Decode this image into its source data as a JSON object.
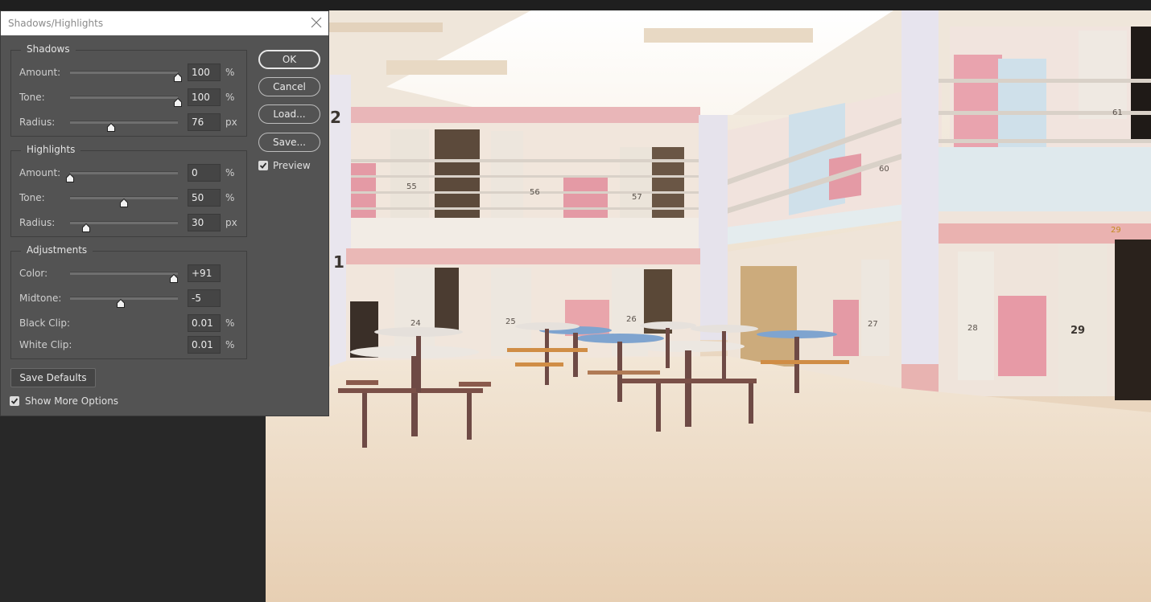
{
  "window": {
    "title": "Shadows/Highlights"
  },
  "shadows": {
    "title": "Shadows",
    "amount": {
      "label": "Amount:",
      "value": "100",
      "unit": "%",
      "level": 1.0
    },
    "tone": {
      "label": "Tone:",
      "value": "100",
      "unit": "%",
      "level": 1.0
    },
    "radius": {
      "label": "Radius:",
      "value": "76",
      "unit": "px",
      "level": 0.38
    }
  },
  "highlights": {
    "title": "Highlights",
    "amount": {
      "label": "Amount:",
      "value": "0",
      "unit": "%",
      "level": 0.0
    },
    "tone": {
      "label": "Tone:",
      "value": "50",
      "unit": "%",
      "level": 0.5
    },
    "radius": {
      "label": "Radius:",
      "value": "30",
      "unit": "px",
      "level": 0.15
    }
  },
  "adjustments": {
    "title": "Adjustments",
    "color": {
      "label": "Color:",
      "value": "+91",
      "level": 0.96
    },
    "midtone": {
      "label": "Midtone:",
      "value": "-5",
      "level": 0.47
    },
    "black_clip": {
      "label": "Black Clip:",
      "value": "0.01",
      "unit": "%"
    },
    "white_clip": {
      "label": "White Clip:",
      "value": "0.01",
      "unit": "%"
    }
  },
  "buttons": {
    "ok": "OK",
    "cancel": "Cancel",
    "load": "Load...",
    "save": "Save...",
    "save_defaults": "Save Defaults"
  },
  "options": {
    "preview": {
      "label": "Preview",
      "checked": true
    },
    "show_more": {
      "label": "Show More Options",
      "checked": true
    }
  },
  "canvas": {
    "numbers": [
      "2",
      "1",
      "55",
      "56",
      "57",
      "24",
      "25",
      "26",
      "27",
      "28",
      "29",
      "29",
      "61",
      "60"
    ]
  }
}
